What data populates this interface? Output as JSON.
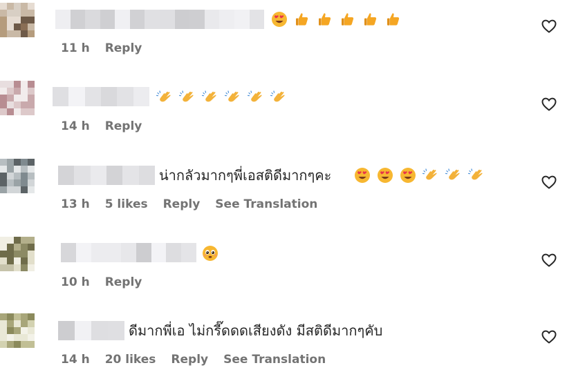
{
  "comments": [
    {
      "text": "",
      "emojis": [
        "heart-eyes",
        "thumbs-up",
        "thumbs-up",
        "thumbs-up",
        "thumbs-up",
        "thumbs-up"
      ],
      "time": "11 h",
      "likes": "",
      "reply": "Reply",
      "translate": ""
    },
    {
      "text": "",
      "emojis": [
        "clap",
        "clap",
        "clap",
        "clap",
        "clap",
        "clap"
      ],
      "time": "14 h",
      "likes": "",
      "reply": "Reply",
      "translate": ""
    },
    {
      "text": "น่ากลัวมากๆพี่เอสติดีมากๆคะ",
      "emojis": [
        "heart-eyes",
        "heart-eyes",
        "heart-eyes",
        "clap",
        "clap",
        "clap"
      ],
      "time": "13 h",
      "likes": "5 likes",
      "reply": "Reply",
      "translate": "See Translation"
    },
    {
      "text": "",
      "emojis": [
        "pleading-face"
      ],
      "time": "10 h",
      "likes": "",
      "reply": "Reply",
      "translate": ""
    },
    {
      "text": "ดีมากพี่เอ ไม่กรี๊ดดดเสียงดัง มีสติดีมากๆคับ",
      "emojis": [],
      "time": "14 h",
      "likes": "20 likes",
      "reply": "Reply",
      "translate": "See Translation"
    }
  ],
  "colors": {
    "text": "#262626",
    "meta": "#737373",
    "emoji_face": "#f7b731",
    "emoji_heart": "#e8334a",
    "emoji_thumb": "#f5a623",
    "emoji_clap": "#f3b23a"
  }
}
